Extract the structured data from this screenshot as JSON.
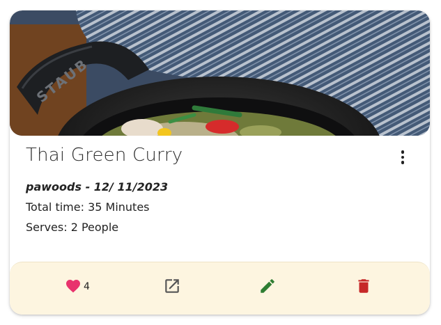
{
  "recipe": {
    "title": "Thai Green Curry",
    "author_date": "pawoods - 12/ 11/2023",
    "total_time": "Total time: 35 Minutes",
    "serves": "Serves: 2 People",
    "image_alt": "Thai green curry in a black cast iron pot on a wooden board with a striped towel",
    "pot_brand": "STAUB"
  },
  "actions": {
    "likes": "4",
    "icons": [
      "heart-icon",
      "open-in-new-icon",
      "pencil-icon",
      "trash-icon",
      "more-vert-icon"
    ]
  },
  "colors": {
    "heart": "#e8336d",
    "open": "#555555",
    "edit": "#2e7d32",
    "delete": "#c62828",
    "actions_bg": "#fdf5e0",
    "title": "#2e2e2e"
  }
}
